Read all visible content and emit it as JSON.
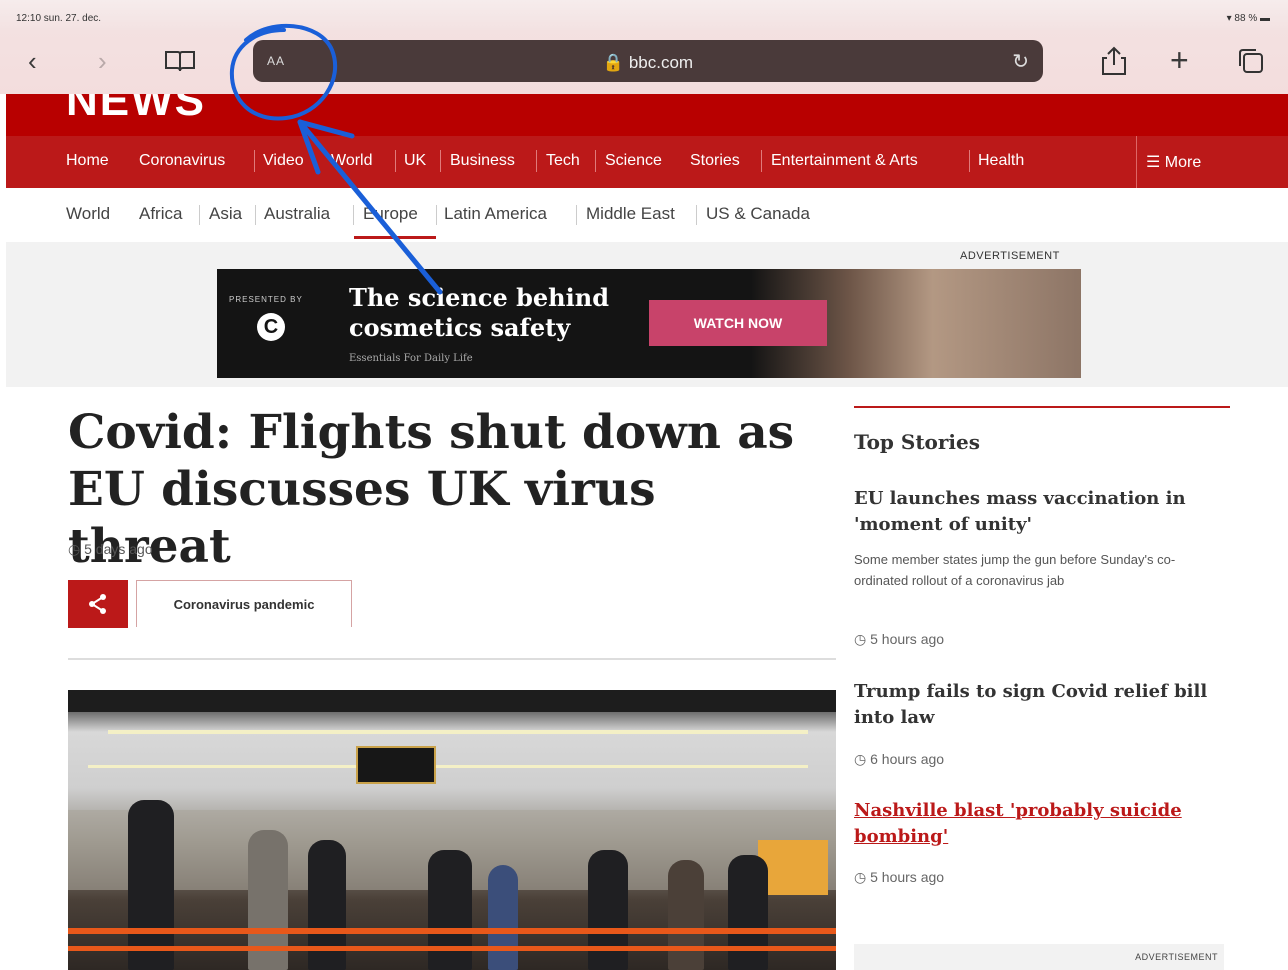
{
  "status_bar": {
    "time": "12:10 sun. 27. dec.",
    "battery": "88 %"
  },
  "safari": {
    "back_icon": "chevron-left-icon",
    "forward_icon": "chevron-right-icon",
    "bookmarks_icon": "book-icon",
    "aa_label": "AA",
    "url": "bbc.com",
    "share_icon": "share-icon",
    "new_tab_label": "+",
    "tabs_icon": "tabs-icon"
  },
  "bbc": {
    "logo": "NEWS",
    "nav": [
      "Home",
      "Coronavirus",
      "Video",
      "World",
      "UK",
      "Business",
      "Tech",
      "Science",
      "Stories",
      "Entertainment & Arts",
      "Health"
    ],
    "more": "More",
    "subnav": [
      "World",
      "Africa",
      "Asia",
      "Australia",
      "Europe",
      "Latin America",
      "Middle East",
      "US & Canada"
    ]
  },
  "ad": {
    "label": "ADVERTISEMENT",
    "presented_by": "PRESENTED BY",
    "headline_1": "The science behind",
    "headline_2": "cosmetics safety",
    "subline": "Essentials For Daily Life",
    "cta": "WATCH NOW"
  },
  "article": {
    "headline": "Covid: Flights shut down as EU discusses UK virus threat",
    "timestamp": "5 days ago",
    "tag": "Coronavirus pandemic"
  },
  "sidebar": {
    "title": "Top Stories",
    "stories": [
      {
        "headline": "EU launches mass vaccination in 'moment of unity'",
        "summary": "Some member states jump the gun before Sunday's co-ordinated rollout of a coronavirus jab",
        "time": "5 hours ago"
      },
      {
        "headline": "Trump fails to sign Covid relief bill into law",
        "time": "6 hours ago"
      },
      {
        "headline": "Nashville blast 'probably suicide bombing'",
        "time": "5 hours ago"
      }
    ],
    "ad_label": "ADVERTISEMENT"
  },
  "colors": {
    "bbc_red": "#bb1919",
    "annotation_blue": "#1a5fd8"
  }
}
